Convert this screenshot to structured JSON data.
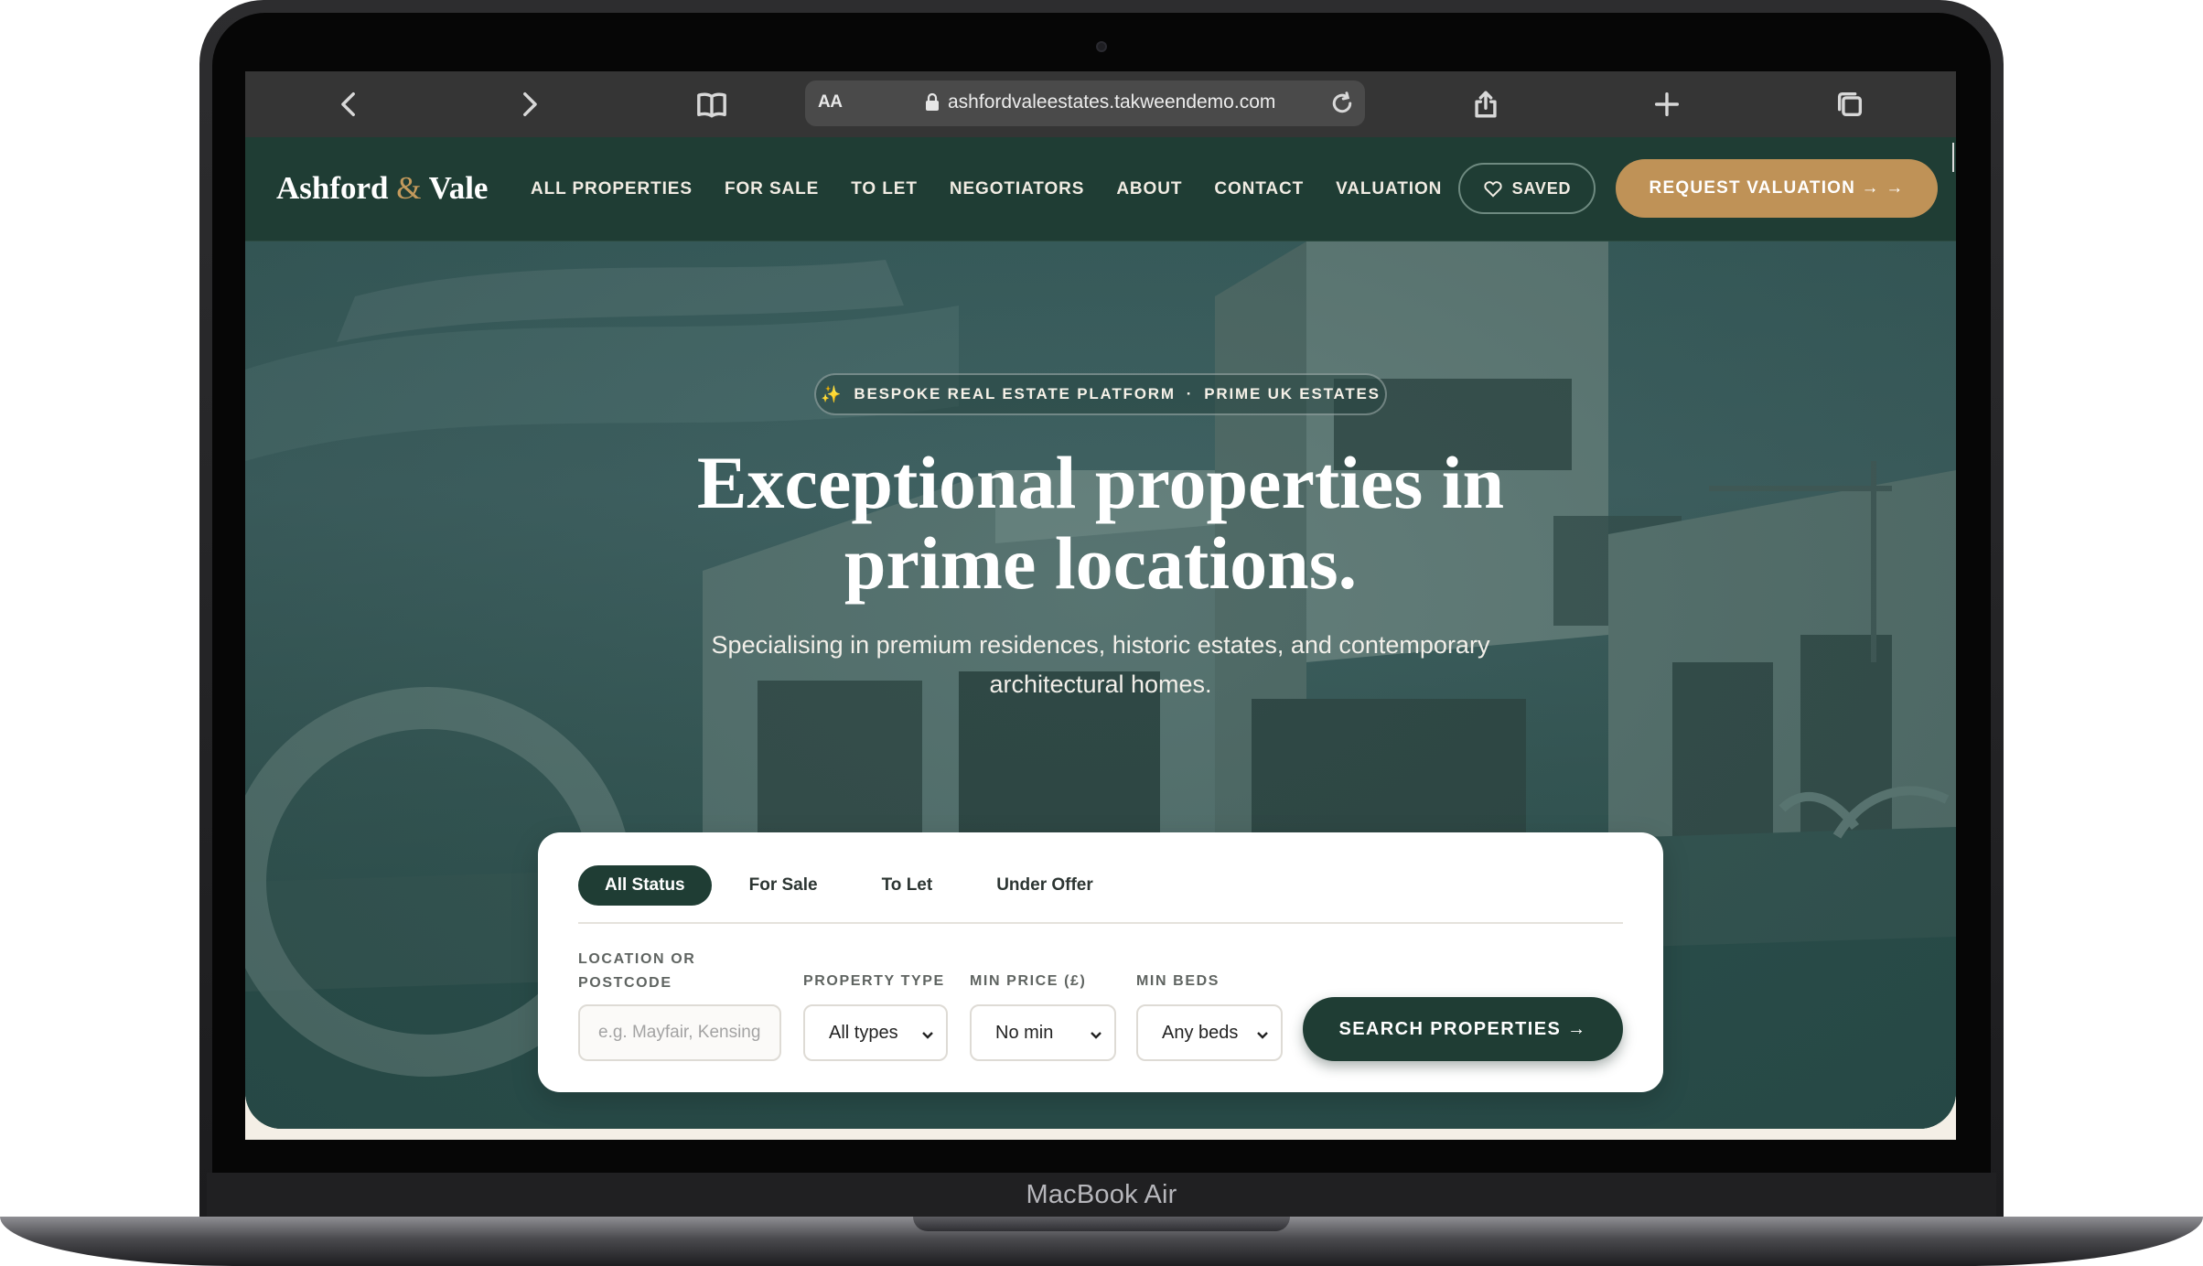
{
  "device": {
    "label": "MacBook Air"
  },
  "browser": {
    "text_size_label": "AA",
    "url": "ashfordvaleestates.takweendemo.com",
    "icons": [
      "chevron-left-icon",
      "chevron-right-icon",
      "book-icon",
      "lock-icon",
      "reload-icon",
      "share-icon",
      "plus-icon",
      "tabs-icon"
    ]
  },
  "site": {
    "logo": {
      "first": "Ashford",
      "amp": "&",
      "last": "Vale"
    },
    "nav": [
      "ALL PROPERTIES",
      "FOR SALE",
      "TO LET",
      "NEGOTIATORS",
      "ABOUT",
      "CONTACT",
      "VALUATION"
    ],
    "saved_label": "SAVED",
    "request_label": "REQUEST VALUATION → →",
    "colors": {
      "header": "#1f3d34",
      "accent": "#bf9257",
      "primary_button": "#1f3d34"
    }
  },
  "hero": {
    "badge_icon": "✨",
    "badge_left": "BESPOKE REAL ESTATE PLATFORM",
    "badge_separator": "·",
    "badge_right": "PRIME UK ESTATES",
    "title_line1": "Exceptional properties in",
    "title_line2": "prime locations.",
    "subtitle": "Specialising in premium residences, historic estates, and contemporary architectural homes."
  },
  "search": {
    "status_tabs": [
      {
        "label": "All Status",
        "active": true
      },
      {
        "label": "For Sale",
        "active": false
      },
      {
        "label": "To Let",
        "active": false
      },
      {
        "label": "Under Offer",
        "active": false
      }
    ],
    "location": {
      "label_line1": "LOCATION OR",
      "label_line2": "POSTCODE",
      "placeholder": "e.g. Mayfair, Kensing"
    },
    "property_type": {
      "label": "PROPERTY TYPE",
      "value": "All types"
    },
    "min_price": {
      "label": "MIN PRICE (£)",
      "value": "No min"
    },
    "min_beds": {
      "label": "MIN BEDS",
      "value": "Any beds"
    },
    "button_label": "SEARCH PROPERTIES →"
  }
}
